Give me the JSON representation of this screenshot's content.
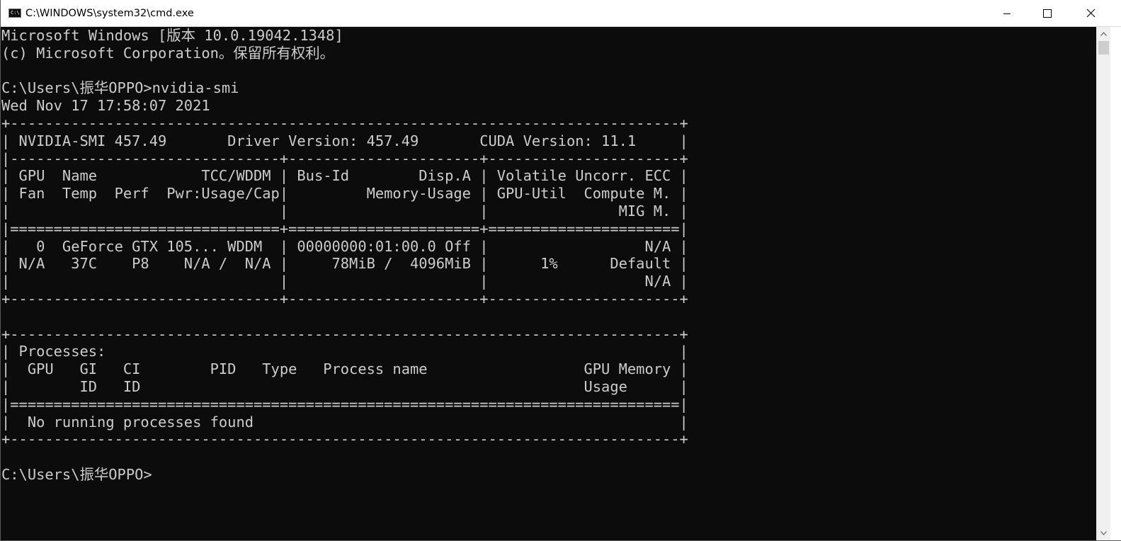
{
  "window": {
    "title": "C:\\WINDOWS\\system32\\cmd.exe",
    "icon_label": "C:\\"
  },
  "terminal": {
    "lines": [
      "Microsoft Windows [版本 10.0.19042.1348]",
      "(c) Microsoft Corporation。保留所有权利。",
      "",
      "C:\\Users\\振华OPPO>nvidia-smi",
      "Wed Nov 17 17:58:07 2021",
      "+-----------------------------------------------------------------------------+",
      "| NVIDIA-SMI 457.49       Driver Version: 457.49       CUDA Version: 11.1     |",
      "|-------------------------------+----------------------+----------------------+",
      "| GPU  Name            TCC/WDDM | Bus-Id        Disp.A | Volatile Uncorr. ECC |",
      "| Fan  Temp  Perf  Pwr:Usage/Cap|         Memory-Usage | GPU-Util  Compute M. |",
      "|                               |                      |               MIG M. |",
      "|===============================+======================+======================|",
      "|   0  GeForce GTX 105... WDDM  | 00000000:01:00.0 Off |                  N/A |",
      "| N/A   37C    P8    N/A /  N/A |     78MiB /  4096MiB |      1%      Default |",
      "|                               |                      |                  N/A |",
      "+-------------------------------+----------------------+----------------------+",
      "",
      "+-----------------------------------------------------------------------------+",
      "| Processes:                                                                  |",
      "|  GPU   GI   CI        PID   Type   Process name                  GPU Memory |",
      "|        ID   ID                                                   Usage      |",
      "|=============================================================================|",
      "|  No running processes found                                                 |",
      "+-----------------------------------------------------------------------------+",
      "",
      "C:\\Users\\振华OPPO>"
    ]
  },
  "colors": {
    "console_bg": "#0c0c0c",
    "console_fg": "#cccccc",
    "titlebar_bg": "#ffffff"
  },
  "icons": {
    "minimize": "minimize-icon",
    "maximize": "maximize-icon",
    "close": "close-icon",
    "scroll_up": "chevron-up-icon",
    "scroll_down": "chevron-down-icon"
  }
}
